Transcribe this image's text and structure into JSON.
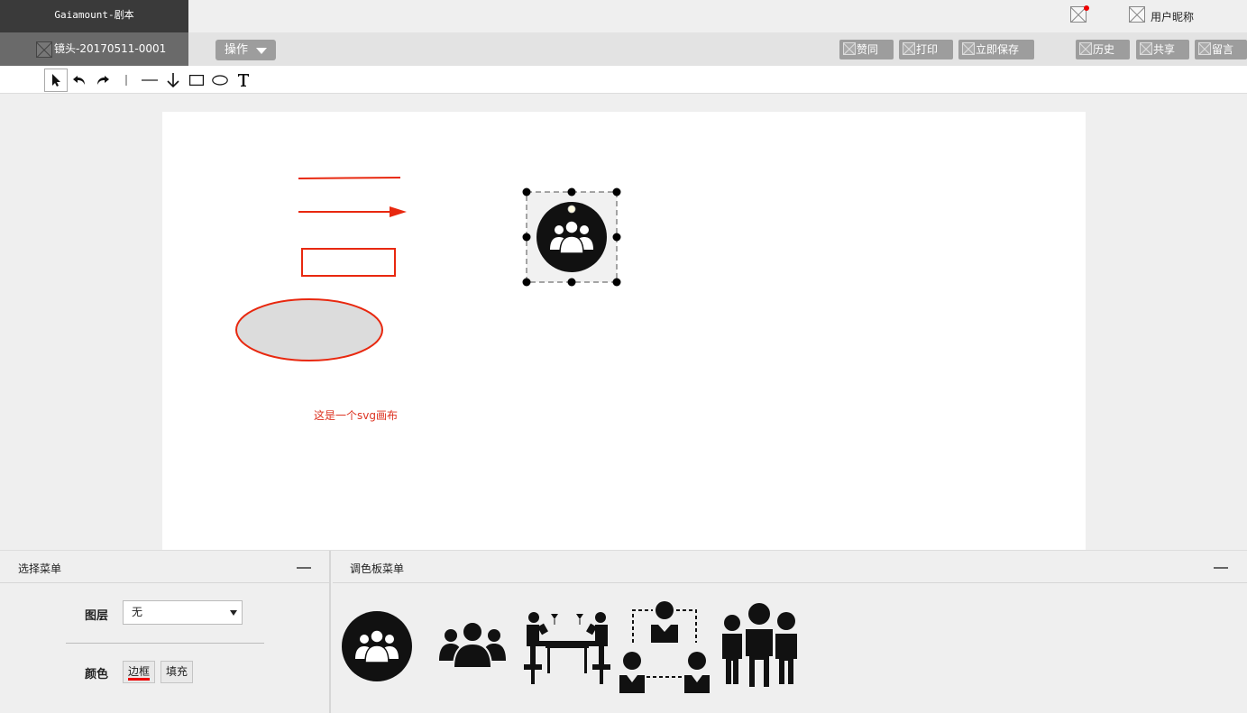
{
  "header": {
    "app_title": "Gaiamount-剧本",
    "user_name": "用户昵称"
  },
  "subbar": {
    "shot_label": "镜头-20170511-0001",
    "ops_label": "操作",
    "actions": {
      "agree": "赞同",
      "print": "打印",
      "save_now": "立即保存",
      "history": "历史",
      "share": "共享",
      "message": "留言"
    }
  },
  "toolbar": {
    "tools": [
      "select-pointer",
      "undo",
      "redo",
      "vertical-line",
      "horizontal-line",
      "arrow-down",
      "rectangle",
      "ellipse",
      "text"
    ]
  },
  "canvas": {
    "text_label": "这是一个svg画布",
    "stroke_color": "#e8280f",
    "ellipse_fill": "#dcdcdc"
  },
  "select_panel": {
    "title": "选择菜单",
    "layer_label": "图层",
    "layer_value": "无",
    "color_label": "颜色",
    "border_button": "边框",
    "fill_button": "填充"
  },
  "palette_panel": {
    "title": "调色板菜单",
    "icons": [
      "group-circle-icon",
      "group-icon",
      "meeting-table-icon",
      "network-people-icon",
      "family-icon"
    ]
  }
}
